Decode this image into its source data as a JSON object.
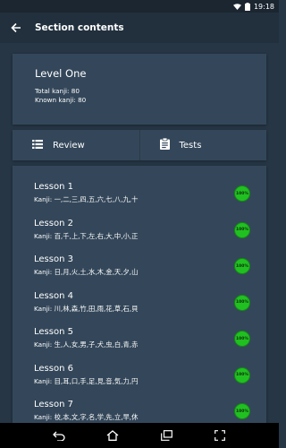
{
  "status_bar": {
    "time": "19:18"
  },
  "app_bar": {
    "title": "Section contents"
  },
  "level": {
    "title": "Level One",
    "total_kanji": "Total kanji: 80",
    "known_kanji": "Known kanji: 80"
  },
  "tabs": {
    "review": "Review",
    "tests": "Tests"
  },
  "lessons": [
    {
      "title": "Lesson 1",
      "kanji": "Kanji: 一,二,三,四,五,六,七,八,九,十",
      "progress": "100%"
    },
    {
      "title": "Lesson 2",
      "kanji": "Kanji: 百,千,上,下,左,右,大,中,小,正",
      "progress": "100%"
    },
    {
      "title": "Lesson 3",
      "kanji": "Kanji: 日,月,火,土,水,木,金,天,夕,山",
      "progress": "100%"
    },
    {
      "title": "Lesson 4",
      "kanji": "Kanji: 川,林,森,竹,田,雨,花,草,石,貝",
      "progress": "100%"
    },
    {
      "title": "Lesson 5",
      "kanji": "Kanji: 生,人,女,男,子,犬,虫,白,青,赤",
      "progress": "100%"
    },
    {
      "title": "Lesson 6",
      "kanji": "Kanji: 目,耳,口,手,足,見,音,気,力,円",
      "progress": "100%"
    },
    {
      "title": "Lesson 7",
      "kanji": "Kanji: 校,本,文,字,名,学,先,立,早,休",
      "progress": "100%"
    }
  ],
  "icons": {
    "back": "arrow-left-icon",
    "review": "list-icon",
    "tests": "clipboard-icon",
    "wifi": "wifi-icon",
    "battery": "battery-icon"
  },
  "colors": {
    "background": "#263645",
    "card": "#34475a",
    "app_bar": "#22303d",
    "progress": "#21c021"
  }
}
